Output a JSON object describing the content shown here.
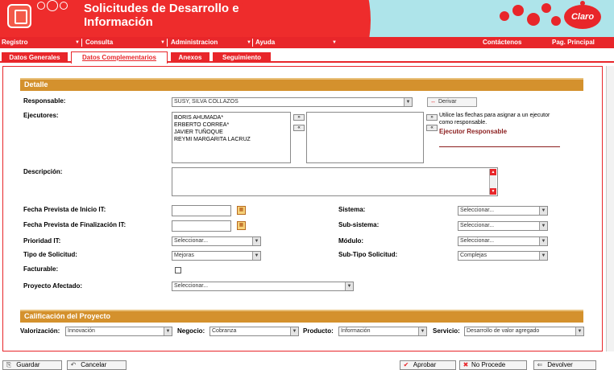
{
  "header": {
    "title_line1": "Solicitudes de Desarrollo e",
    "title_line2": "Información",
    "brand": "Claro"
  },
  "menu": {
    "items": [
      "Registro",
      "Consulta",
      "Administracion",
      "Ayuda"
    ],
    "right_links": [
      "Contáctenos",
      "Pag. Principal"
    ]
  },
  "tabs": [
    {
      "label": "Datos Generales",
      "active": false
    },
    {
      "label": "Datos Complementarios",
      "active": true
    },
    {
      "label": "Anexos",
      "active": false
    },
    {
      "label": "Seguimiento",
      "active": false
    }
  ],
  "detalle": {
    "section_title": "Detalle",
    "responsable_label": "Responsable:",
    "responsable_value": "SUSY, SILVA COLLAZOS",
    "derivar_button": "Derivar",
    "ejecutores_label": "Ejecutores:",
    "ejecutores_available": [
      "BORIS AHUMADA*",
      "ERBERTO CORREA*",
      "JAVIER TUÑOQUE",
      "REYMI MARGARITA LACRUZ"
    ],
    "ejecutores_hint": "Utilice las flechas para asignar a un ejecutor como responsable.",
    "ejecutor_responsable_label": "Ejecutor Responsable",
    "descripcion_label": "Descripción:",
    "fecha_inicio_label": "Fecha Prevista de Inicio IT:",
    "fecha_fin_label": "Fecha Prevista de Finalización IT:",
    "prioridad_label": "Prioridad IT:",
    "prioridad_value": "Seleccionar...",
    "tipo_label": "Tipo de Solicitud:",
    "tipo_value": "Mejoras",
    "facturable_label": "Facturable:",
    "proyecto_label": "Proyecto Afectado:",
    "proyecto_value": "Seleccionar...",
    "sistema_label": "Sistema:",
    "sistema_value": "Seleccionar...",
    "subsistema_label": "Sub-sistema:",
    "subsistema_value": "Seleccionar...",
    "modulo_label": "Módulo:",
    "modulo_value": "Seleccionar...",
    "subtipo_label": "Sub-Tipo Solicitud:",
    "subtipo_value": "Complejas"
  },
  "calificacion": {
    "section_title": "Calificación del Proyecto",
    "valorizacion_label": "Valorización:",
    "valorizacion_value": "Innovación",
    "negocio_label": "Negocio:",
    "negocio_value": "Cobranza",
    "producto_label": "Producto:",
    "producto_value": "Información",
    "servicio_label": "Servicio:",
    "servicio_value": "Desarrollo de valor agregado"
  },
  "actions": {
    "guardar": "Guardar",
    "cancelar": "Cancelar",
    "aprobar": "Aprobar",
    "no_procede": "No Procede",
    "devolver": "Devolver"
  },
  "colors": {
    "brand_red": "#e8262a",
    "section_gold": "#d4912d",
    "header_cyan": "#aee4ea"
  }
}
